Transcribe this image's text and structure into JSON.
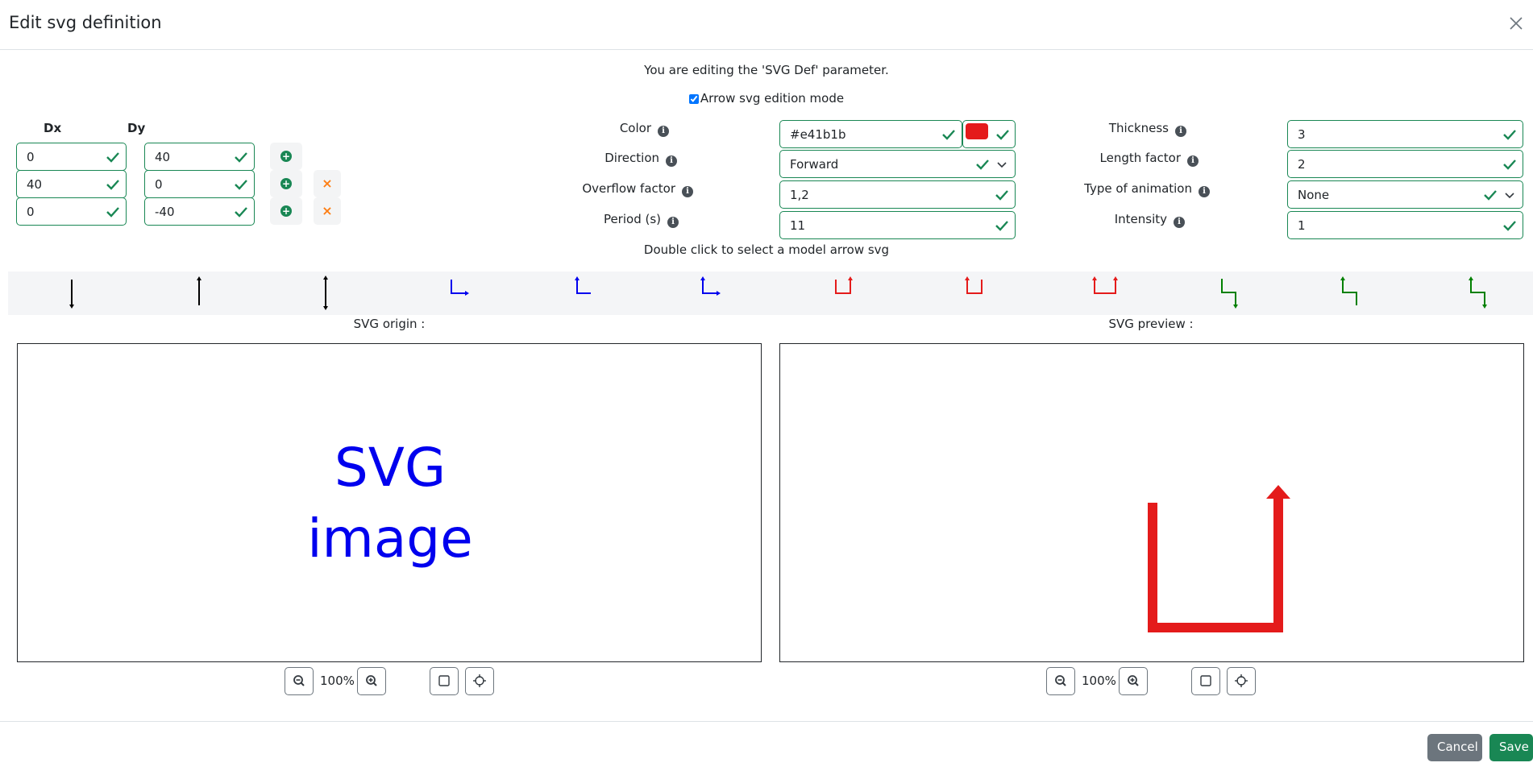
{
  "modal": {
    "title": "Edit svg definition",
    "editing_text": "You are editing the 'SVG Def' parameter.",
    "arrow_mode_label": "Arrow svg edition mode",
    "arrow_mode_checked": true,
    "model_hint": "Double click to select a model arrow svg"
  },
  "points": {
    "dx_header": "Dx",
    "dy_header": "Dy",
    "rows": [
      {
        "dx": "0",
        "dy": "40"
      },
      {
        "dx": "40",
        "dy": "0"
      },
      {
        "dx": "0",
        "dy": "-40"
      }
    ]
  },
  "params": {
    "color_label": "Color",
    "color_value": "#e41b1b",
    "direction_label": "Direction",
    "direction_value": "Forward",
    "overflow_label": "Overflow factor",
    "overflow_value": "1,2",
    "period_label": "Period (s)",
    "period_value": "11",
    "thickness_label": "Thickness",
    "thickness_value": "3",
    "length_label": "Length factor",
    "length_value": "2",
    "animation_label": "Type of animation",
    "animation_value": "None",
    "intensity_label": "Intensity",
    "intensity_value": "1"
  },
  "models": [
    {
      "color": "#000000",
      "icon": "arrow-down-icon"
    },
    {
      "color": "#000000",
      "icon": "arrow-up-icon"
    },
    {
      "color": "#000000",
      "icon": "arrow-both-vertical-icon"
    },
    {
      "color": "#0000ee",
      "icon": "corner-right-arrow-icon"
    },
    {
      "color": "#0000ee",
      "icon": "corner-up-arrow-icon"
    },
    {
      "color": "#0000ee",
      "icon": "corner-both-arrow-icon"
    },
    {
      "color": "#e41b1b",
      "icon": "u-up-right-arrow-icon"
    },
    {
      "color": "#e41b1b",
      "icon": "u-up-left-arrow-icon"
    },
    {
      "color": "#e41b1b",
      "icon": "u-both-arrow-icon"
    },
    {
      "color": "#008000",
      "icon": "step-down-arrow-icon"
    },
    {
      "color": "#008000",
      "icon": "step-up-arrow-icon"
    },
    {
      "color": "#008000",
      "icon": "step-both-arrow-icon"
    }
  ],
  "origin": {
    "title": "SVG origin :",
    "placeholder_line1": "SVG",
    "placeholder_line2": "image",
    "zoom": "100%"
  },
  "preview": {
    "title": "SVG preview :",
    "zoom": "100%",
    "arrow_color": "#e41b1b"
  },
  "footer": {
    "cancel_label": "Cancel",
    "save_label": "Save"
  },
  "colors": {
    "success": "#198754",
    "secondary": "#6c757d",
    "danger_icon": "#fd7e14"
  }
}
